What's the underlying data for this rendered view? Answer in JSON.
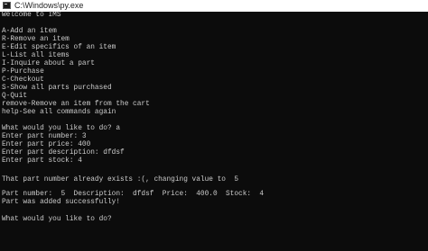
{
  "window": {
    "title": "C:\\Windows\\py.exe",
    "icon": "console-app-icon"
  },
  "console": {
    "lines": [
      "Welcome to IMS",
      "A-Add an item",
      "R-Remove an item",
      "E-Edit specifics of an item",
      "L-List all items",
      "I-Inquire about a part",
      "P-Purchase",
      "C-Checkout",
      "S-Show all parts purchased",
      "Q-Quit",
      "remove-Remove an item from the cart",
      "help-See all commands again",
      "What would you like to do? a",
      "Enter part number: 3",
      "Enter part price: 400",
      "Enter part description: dfdsf",
      "Enter part stock: 4",
      "That part number already exists :(, changing value to  5",
      "Part number:  5  Description:  dfdsf  Price:  400.0  Stock:  4",
      "Part was added successfully!",
      "What would you like to do?"
    ]
  },
  "colors": {
    "console_background": "#0c0c0c",
    "console_text": "#cccccc",
    "titlebar_background": "#ffffff"
  }
}
